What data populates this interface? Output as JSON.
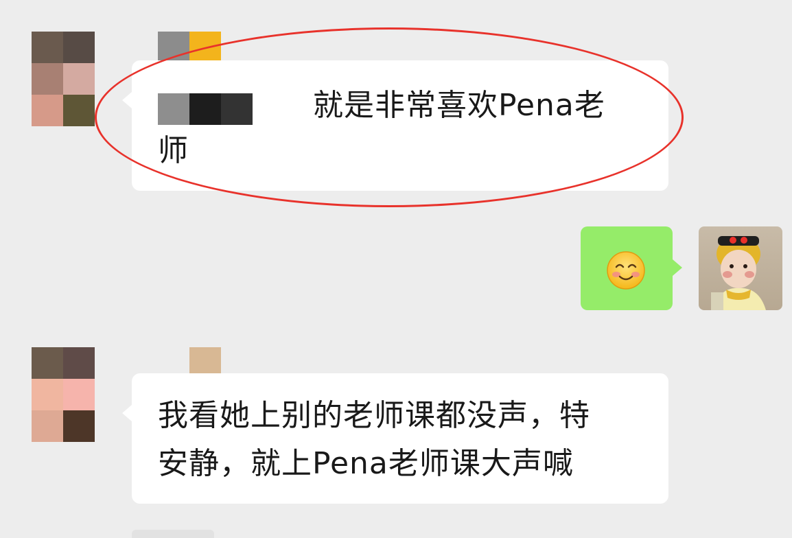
{
  "messages": [
    {
      "side": "left",
      "text_line1": "就是非常喜欢Pena老",
      "text_line2": "师"
    },
    {
      "side": "right",
      "emoji": "😊",
      "emoji_name": "smile-emoji"
    },
    {
      "side": "left",
      "text_line1": "我看她上别的老师课都没声，特",
      "text_line2": "安静，就上Pena老师课大声喊"
    }
  ],
  "colors": {
    "background": "#ededed",
    "bubble_received": "#ffffff",
    "bubble_sent": "#95ec69",
    "annotation": "#e8322b"
  }
}
